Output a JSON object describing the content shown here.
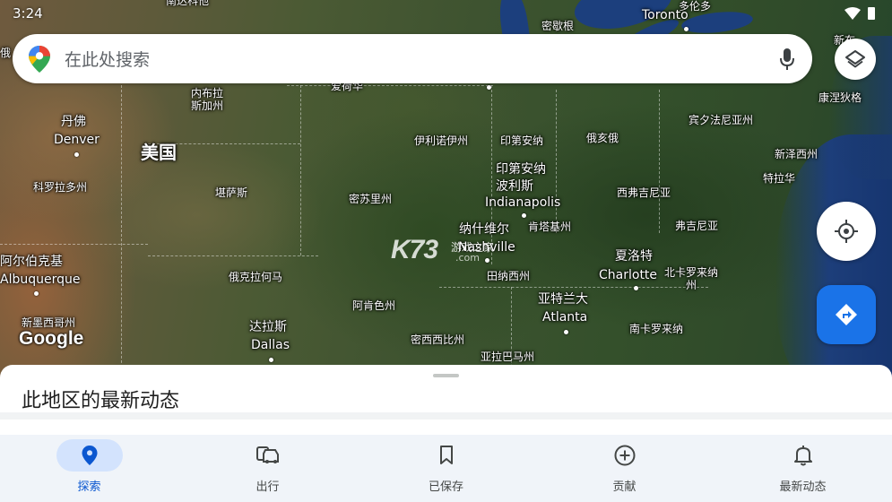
{
  "status_bar": {
    "time": "3:24"
  },
  "search": {
    "placeholder": "在此处搜索"
  },
  "map": {
    "logo": "Google",
    "watermark": {
      "brand": "K73",
      "sub": "游戏之家",
      "domain": ".com"
    },
    "labels": {
      "nanda_kota": "南达科他",
      "mi_qie_gen": "密歇根",
      "toronto": "Toronto",
      "ka_top": "多伦多",
      "jia_fen": "新布",
      "nebraska": "内布拉\n斯加州",
      "denver_cn": "丹佛",
      "denver": "Denver",
      "usa": "美国",
      "colorado": "科罗拉多州",
      "kansas": "堪萨斯",
      "missouri": "密苏里州",
      "illinois": "伊利诺伊州",
      "indiana": "印第安纳",
      "ohio": "俄亥俄",
      "pennsylvania": "宾夕法尼亚州",
      "new_jersey": "新泽西州",
      "delaware": "特拉华",
      "connecticut": "康涅狄格",
      "indianapolis_cn": "印第安纳\n波利斯",
      "indianapolis": "Indianapolis",
      "west_virginia": "西弗吉尼亚",
      "virginia": "弗吉尼亚",
      "kentucky": "肯塔基州",
      "nashville_cn": "纳什维尔",
      "nashville": "Nashville",
      "tennessee": "田纳西州",
      "albuquerque_cn": "阿尔伯克基",
      "albuquerque": "Albuquerque",
      "oklahoma": "俄克拉何马",
      "arkansas": "阿肯色州",
      "charlotte_cn": "夏洛特",
      "charlotte": "Charlotte",
      "north_carolina": "北卡罗来纳\n州",
      "atlanta_cn": "亚特兰大",
      "atlanta": "Atlanta",
      "south_carolina": "南卡罗来纳",
      "new_mexico": "新墨西哥州",
      "dallas_cn": "达拉斯",
      "dallas": "Dallas",
      "mississippi": "密西西比州",
      "alabama": "亚拉巴马州",
      "iowa": "爱荷华",
      "wyoming": "俄明",
      "top_left_edge": "俄"
    }
  },
  "sheet": {
    "title": "此地区的最新动态"
  },
  "nav": {
    "items": [
      {
        "label": "探索",
        "icon": "location-pin-icon",
        "active": true
      },
      {
        "label": "出行",
        "icon": "car-icon",
        "active": false
      },
      {
        "label": "已保存",
        "icon": "bookmark-icon",
        "active": false
      },
      {
        "label": "贡献",
        "icon": "add-circle-icon",
        "active": false
      },
      {
        "label": "最新动态",
        "icon": "bell-icon",
        "active": false
      }
    ]
  },
  "colors": {
    "accent": "#1a73e8",
    "active_nav": "#0b57d0",
    "active_pill": "#d3e3fd"
  }
}
